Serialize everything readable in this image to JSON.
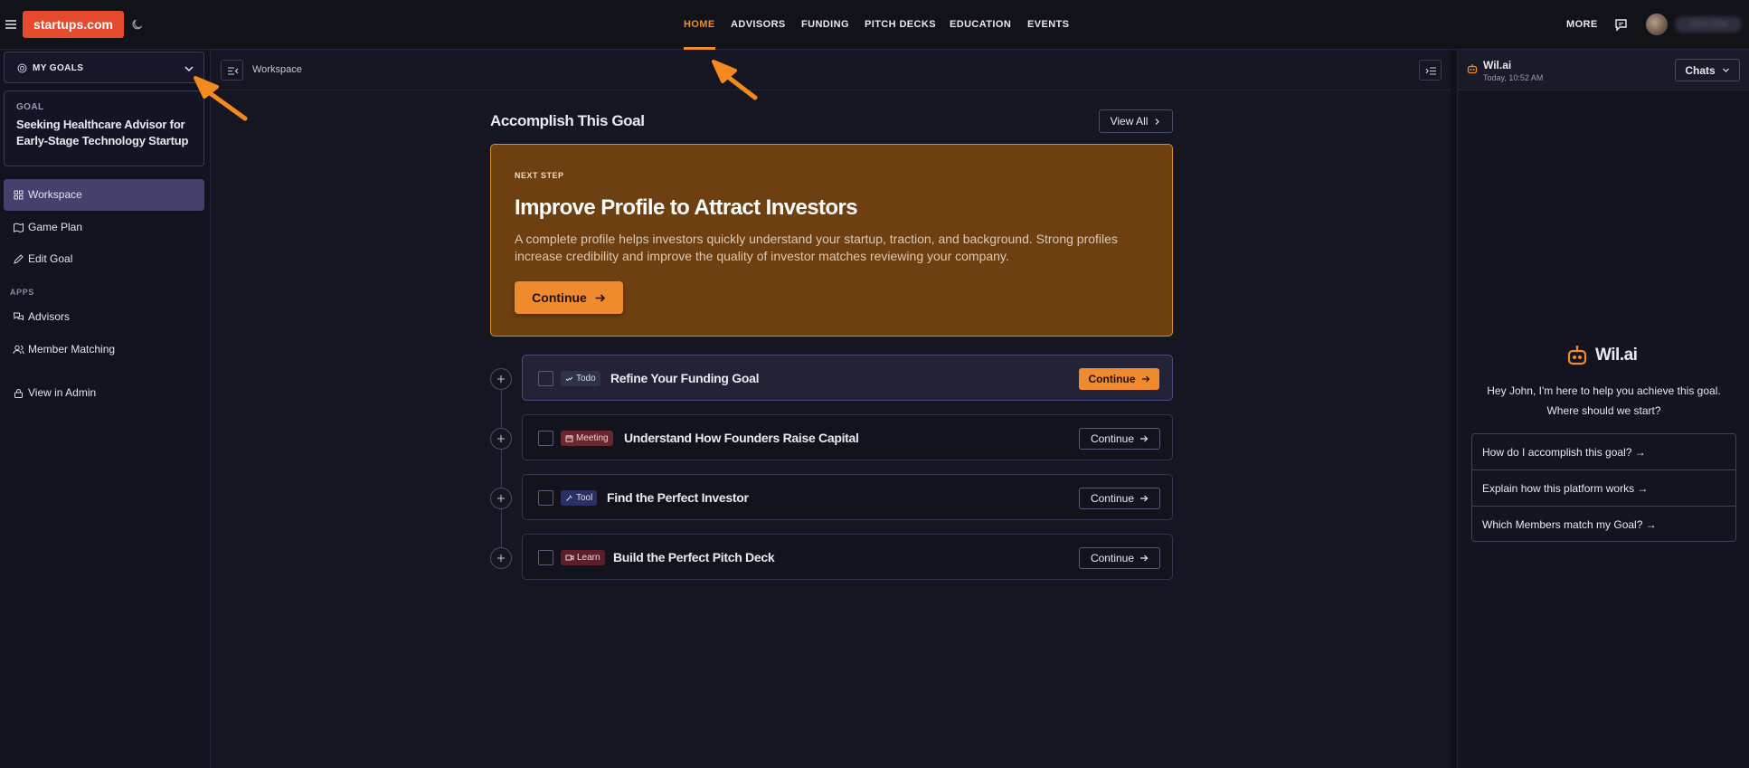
{
  "header": {
    "brand": "startups.com",
    "nav": [
      {
        "label": "HOME",
        "active": true
      },
      {
        "label": "ADVISORS",
        "active": false
      },
      {
        "label": "FUNDING",
        "active": false
      },
      {
        "label": "PITCH DECKS",
        "active": false
      },
      {
        "label": "EDUCATION",
        "active": false
      },
      {
        "label": "EVENTS",
        "active": false
      }
    ],
    "more": "MORE",
    "user_name": "John Doe"
  },
  "sidebar": {
    "goals_dropdown": "MY GOALS",
    "goal_tag": "GOAL",
    "goal_title": "Seeking Healthcare Advisor for Early-Stage Technology Startup",
    "items": [
      {
        "label": "Workspace",
        "icon": "grid-icon",
        "active": true
      },
      {
        "label": "Game Plan",
        "icon": "map-icon",
        "active": false
      },
      {
        "label": "Edit Goal",
        "icon": "pencil-icon",
        "active": false
      }
    ],
    "apps_header": "APPS",
    "apps": [
      {
        "label": "Advisors",
        "icon": "chat-bubbles-icon"
      },
      {
        "label": "Member Matching",
        "icon": "users-icon"
      }
    ],
    "admin": {
      "label": "View in Admin",
      "icon": "lock-icon"
    }
  },
  "workspace": {
    "breadcrumb": "Workspace",
    "section_title": "Accomplish This Goal",
    "view_all": "View All",
    "next_step": {
      "kicker": "NEXT STEP",
      "title": "Improve Profile to Attract Investors",
      "description": "A complete profile helps investors quickly understand your startup, traction, and background. Strong profiles increase credibility and improve the quality of investor matches reviewing your company.",
      "cta": "Continue"
    },
    "tasks": [
      {
        "type": "Todo",
        "title": "Refine Your Funding Goal",
        "cta": "Continue",
        "highlight": true
      },
      {
        "type": "Meeting",
        "title": "Understand How Founders Raise Capital",
        "cta": "Continue",
        "highlight": false
      },
      {
        "type": "Tool",
        "title": "Find the Perfect Investor",
        "cta": "Continue",
        "highlight": false
      },
      {
        "type": "Learn",
        "title": "Build the Perfect Pitch Deck",
        "cta": "Continue",
        "highlight": false
      }
    ]
  },
  "chat": {
    "name": "Wil.ai",
    "timestamp": "Today, 10:52 AM",
    "chats_button": "Chats",
    "logo_text": "Wil.ai",
    "greeting_line1": "Hey John, I'm here to help you achieve this goal.",
    "greeting_line2": "Where should we start?",
    "suggestions": [
      "How do I accomplish this goal?",
      "Explain how this platform works",
      "Which Members match my Goal?"
    ]
  },
  "colors": {
    "accent": "#f08a2e",
    "brand": "#e64a2e",
    "next_card_bg": "#6e3f10",
    "active_sidebar": "#45406c",
    "annotation_arrow": "#f28a1e"
  }
}
